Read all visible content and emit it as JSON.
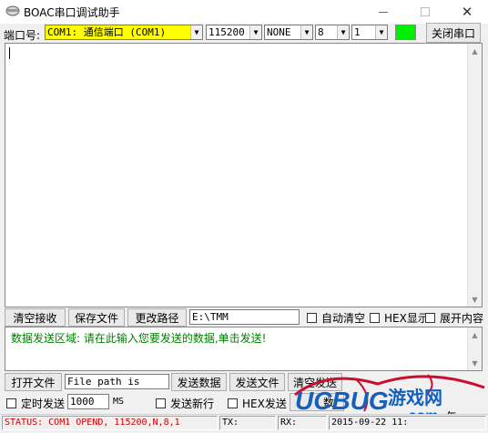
{
  "window": {
    "title": "BOAC串口调试助手",
    "icons": {
      "app": "app-icon",
      "minimize": "minimize-icon",
      "maximize": "maximize-icon",
      "close": "close-icon"
    }
  },
  "toolbar": {
    "port_label": "端口号:",
    "port_value": "COM1: 通信端口 (COM1)",
    "baud_value": "115200",
    "parity_value": "NONE",
    "databits_value": "8",
    "stopbits_value": "1",
    "led_color": "#00ee00",
    "close_port_label": "关闭串口"
  },
  "receive": {
    "content": ""
  },
  "recv_controls": {
    "clear_label": "清空接收",
    "save_label": "保存文件",
    "change_path_label": "更改路径",
    "path_value": "E:\\TMM",
    "auto_clear_label": "自动清空",
    "hex_display_label": "HEX显示",
    "expand_label": "展开内容"
  },
  "send": {
    "hint": "数据发送区域: 请在此输入您要发送的数据,单击发送!",
    "open_file_label": "打开文件",
    "file_path_value": "File path is",
    "send_data_label": "发送数据",
    "send_file_label": "发送文件",
    "clear_send_label": "清空发送",
    "timed_send_label": "定时发送",
    "interval_value": "1000",
    "interval_unit": "MS",
    "send_newline_label": "发送新行",
    "hex_send_label": "HEX发送",
    "partial_button_label": "数"
  },
  "status_bar": {
    "status": "STATUS: COM1 OPEND, 115200,N,8,1",
    "tx": "TX:",
    "rx": "RX:",
    "datetime": "2015-09-22  11:"
  },
  "watermark": {
    "text_ucbug": "UCBUG",
    "text_game": "游戏网",
    "text_com": ".com",
    "text_extra": "午",
    "colors": {
      "blue": "#1560bd",
      "red": "#c8102e"
    }
  }
}
